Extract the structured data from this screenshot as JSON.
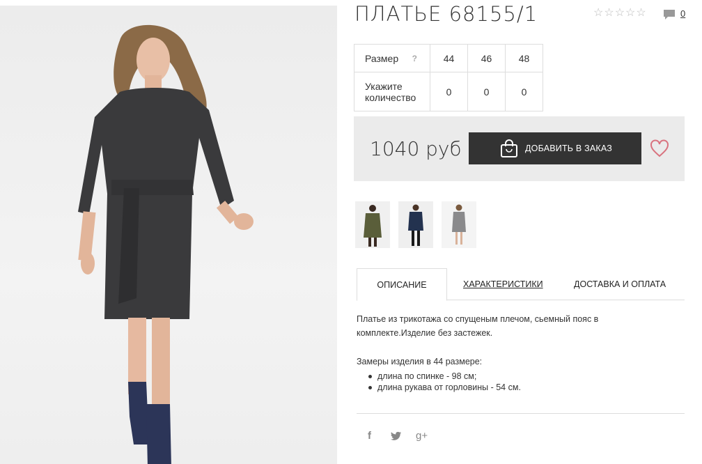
{
  "product": {
    "title": "ПЛАТЬЕ 68155/1",
    "rating_stars": 0,
    "comments_count": "0",
    "icons": {
      "rating": "star-icon",
      "comments": "comment-icon",
      "help": "question-icon",
      "cart": "shopping-bag-icon",
      "favorite": "heart-icon"
    }
  },
  "size_table": {
    "size_label": "Размер",
    "help_mark": "?",
    "qty_label": "Укажите количество",
    "sizes": [
      "44",
      "46",
      "48"
    ],
    "quantities": [
      "0",
      "0",
      "0"
    ]
  },
  "purchase": {
    "price": "1040 руб",
    "add_button_label": "ДОБАВИТЬ В ЗАКАЗ",
    "accent_color": "#d9737f"
  },
  "tabs": {
    "description": "ОПИСАНИЕ",
    "characteristics": "ХАРАКТЕРИСТИКИ",
    "delivery": "ДОСТАВКА И ОПЛАТА"
  },
  "description": {
    "text": "Платье из трикотажа со спущеным плечом, сьемный пояс в комплекте.Изделие без застежек.",
    "measurements_title": "Замеры изделия в 44 размере:",
    "measurements": [
      "длина по спинке - 98 см;",
      "длина рукава от горловины - 54 см."
    ]
  },
  "social": {
    "facebook": "f",
    "twitter": "twitter-icon",
    "google_plus": "g+"
  }
}
